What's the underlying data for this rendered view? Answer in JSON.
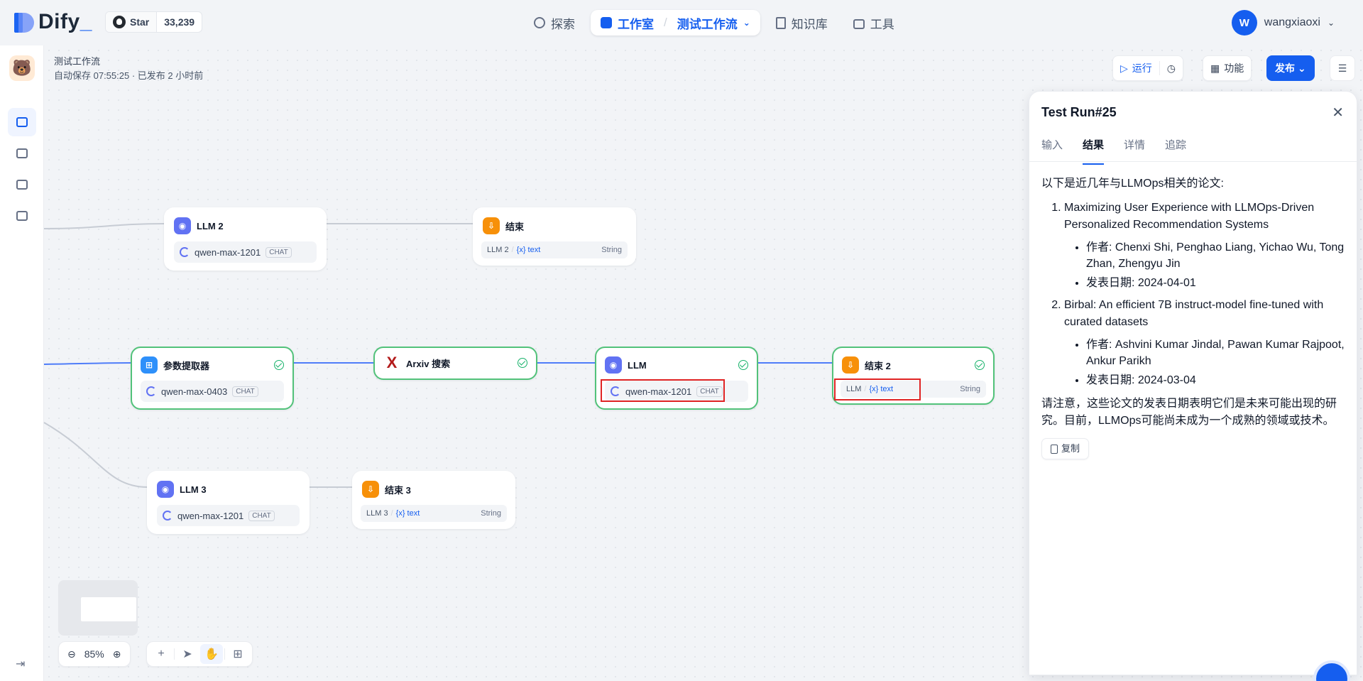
{
  "brand": {
    "logo_text": "Dify",
    "logo_suffix": "_"
  },
  "github": {
    "star_label": "Star",
    "star_count": "33,239"
  },
  "nav": {
    "explore": "探索",
    "studio": "工作室",
    "current_app": "测试工作流",
    "knowledge": "知识库",
    "tools": "工具"
  },
  "user": {
    "initial": "W",
    "name": "wangxiaoxi"
  },
  "workflow": {
    "title": "测试工作流",
    "subtitle": "自动保存 07:55:25 · 已发布 2 小时前"
  },
  "toolbar": {
    "run_label": "运行",
    "features_label": "功能",
    "publish_label": "发布"
  },
  "nodes": {
    "llm2": {
      "title": "LLM 2",
      "model": "qwen-max-1201",
      "tag": "CHAT"
    },
    "end1": {
      "title": "结束",
      "var_src": "LLM 2",
      "var_name": "{x} text",
      "var_type": "String"
    },
    "param": {
      "title": "参数提取器",
      "model": "qwen-max-0403",
      "tag": "CHAT"
    },
    "arxiv": {
      "title": "Arxiv 搜索",
      "icon": "X"
    },
    "llm": {
      "title": "LLM",
      "model": "qwen-max-1201",
      "tag": "CHAT"
    },
    "end2": {
      "title": "结束 2",
      "var_src": "LLM",
      "var_name": "{x} text",
      "var_type": "String"
    },
    "llm3": {
      "title": "LLM 3",
      "model": "qwen-max-1201",
      "tag": "CHAT"
    },
    "end3": {
      "title": "结束 3",
      "var_src": "LLM 3",
      "var_name": "{x} text",
      "var_type": "String"
    }
  },
  "zoom": {
    "level": "85%"
  },
  "panel": {
    "title": "Test Run#25",
    "tabs": [
      "输入",
      "结果",
      "详情",
      "追踪"
    ],
    "active_tab": "结果",
    "intro": "以下是近几年与LLMOps相关的论文:",
    "papers": [
      {
        "title": "Maximizing User Experience with LLMOps-Driven Personalized Recommendation Systems",
        "authors": "作者: Chenxi Shi, Penghao Liang, Yichao Wu, Tong Zhan, Zhengyu Jin",
        "date": "发表日期: 2024-04-01"
      },
      {
        "title": "Birbal: An efficient 7B instruct-model fine-tuned with curated datasets",
        "authors": "作者: Ashvini Kumar Jindal, Pawan Kumar Rajpoot, Ankur Parikh",
        "date": "发表日期: 2024-03-04"
      }
    ],
    "note": "请注意，这些论文的发表日期表明它们是未来可能出现的研究。目前，LLMOps可能尚未成为一个成熟的领域或技术。",
    "copy_label": "复制"
  }
}
